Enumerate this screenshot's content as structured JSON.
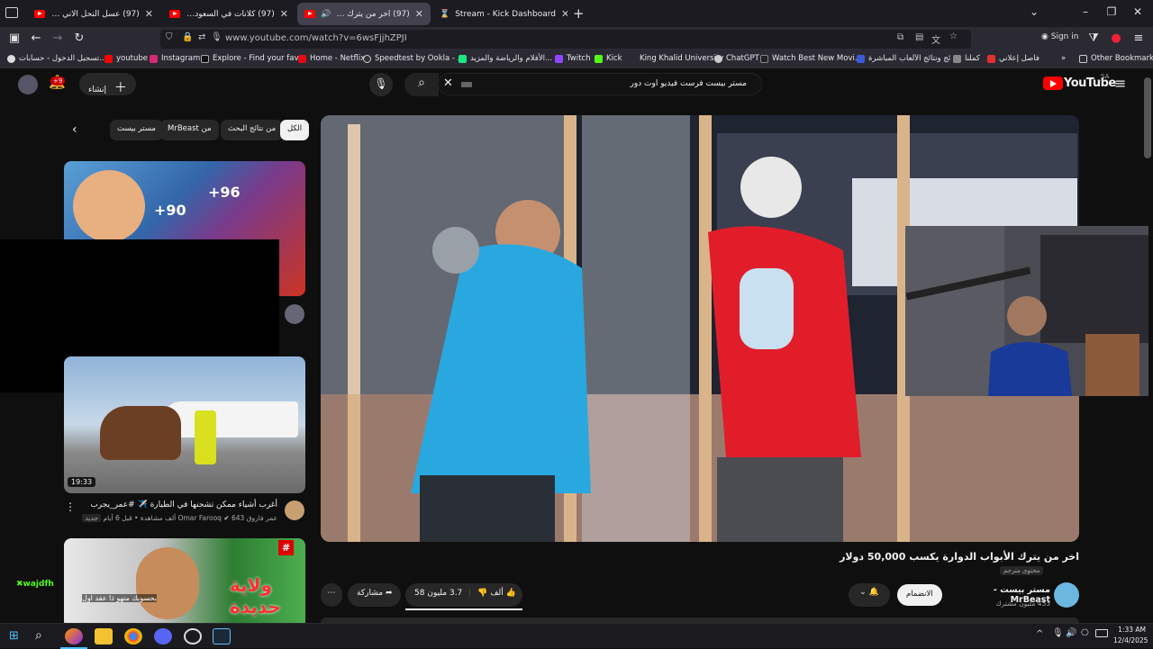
{
  "tabs": [
    {
      "title": "(97) عسل النحل الاني ياهو - ...be",
      "active": false
    },
    {
      "title": "(97) كلانات في السعوديه - ...Tube",
      "active": false
    },
    {
      "title": "(97) اخر من يترك الأبواب الد...",
      "active": true
    },
    {
      "title": "Stream - Kick Dashboard",
      "active": false
    }
  ],
  "address": {
    "url": "www.youtube.com/watch?v=6wsFjjhZPJI",
    "sign_in": "Sign in"
  },
  "bookmarks": [
    "تسجيل الدخول - حسابات...",
    "youtube",
    "Instagram",
    "Explore - Find your fav...",
    "Home - Netflix",
    "Speedtest by Ookla - ...",
    "الأفلام والرياضة والمزيد...",
    "Twitch",
    "Kick",
    "King Khalid University",
    "ChatGPT",
    "Watch Best New Movi...",
    "نتائج ونتائج الألعاب المباشرة...",
    "كملنا",
    "فاصل إعلاني",
    "Other Bookmarks"
  ],
  "youtube": {
    "logo": "YouTube",
    "region": "SA",
    "search_query": "مستر بيست فرست فيديو اوت دور",
    "create_label": "إنشاء",
    "notif_count": "+9",
    "chips": [
      "الكل",
      "من نتائج البحث",
      "من MrBeast",
      "مستر بيست"
    ],
    "video": {
      "title": "اخر من يترك الأبواب الدوارة يكسب 50,000 دولار",
      "channel": "مستر بيست - MrBeast",
      "subscribers": "453 مليون مشترك",
      "subscribe_label": "الانضمام",
      "likes": "3.7 مليون",
      "dislikes": "58 ألف",
      "share_label": "مشاركة",
      "badge": "محتوى مترجم"
    },
    "related": [
      {
        "title": "أغرب أشياء ممكن تشحنها في الطيارة ✈️ #عمر_يجرب",
        "channel": "عمر فاروق Omar Farooq",
        "meta": "643 ألف مشاهدة • قبل 6 أيام",
        "badge": "جديد",
        "duration": "19:33"
      },
      {
        "thumb_text": "ولاية حديدة",
        "overlay": "بحسوبك متهو ذا عقد اول",
        "chat_user": "wajdfh"
      }
    ]
  },
  "taskbar": {
    "time": "1:33 AM",
    "date": "12/4/2025"
  }
}
